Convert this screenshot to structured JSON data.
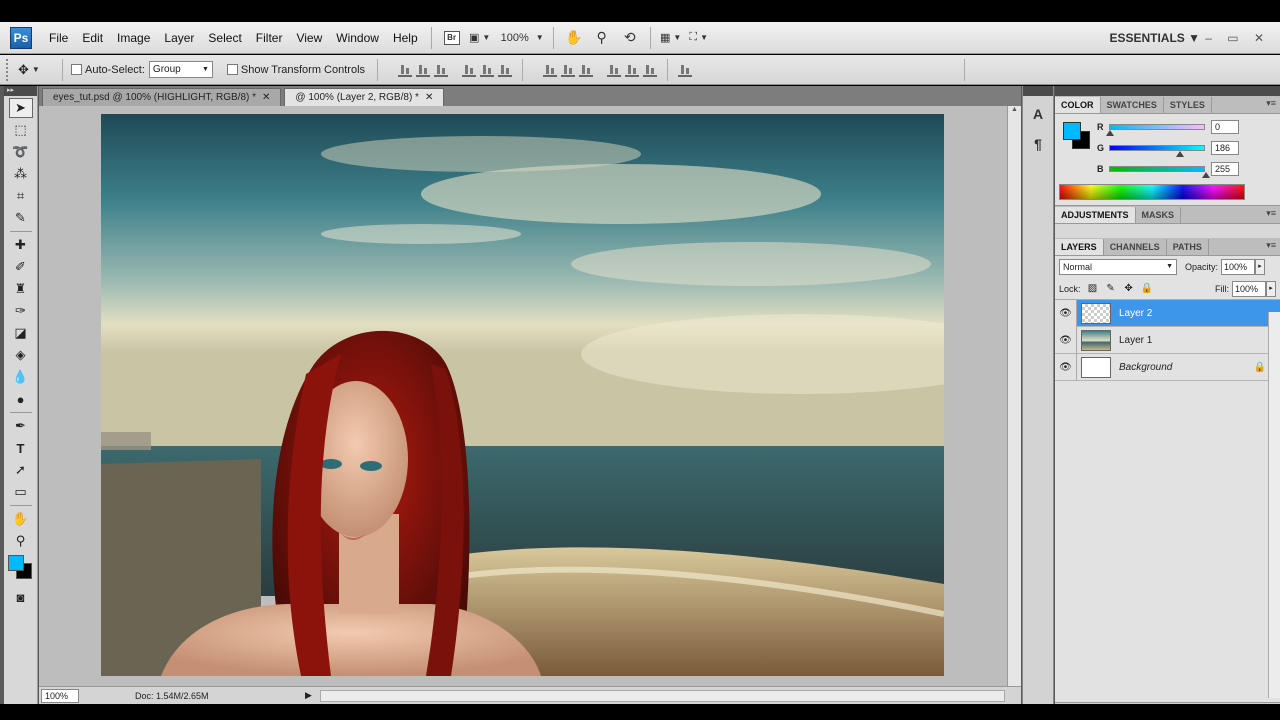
{
  "app": {
    "logo": "Ps"
  },
  "menu": [
    "File",
    "Edit",
    "Image",
    "Layer",
    "Select",
    "Filter",
    "View",
    "Window",
    "Help"
  ],
  "menubar": {
    "bridge": "Br",
    "zoom": "100%",
    "workspace": "ESSENTIALS ▼",
    "window_controls": "–  ▭  ✕"
  },
  "options": {
    "auto_select_label": "Auto-Select:",
    "auto_select_value": "Group",
    "show_transform_label": "Show Transform Controls"
  },
  "tabs": [
    {
      "label": "eyes_tut.psd @ 100% (HIGHLIGHT, RGB/8) *",
      "active": false
    },
    {
      "label": "@ 100% (Layer 2, RGB/8) *",
      "active": true
    }
  ],
  "status": {
    "zoom": "100%",
    "doc": "Doc: 1.54M/2.65M"
  },
  "color_panel": {
    "tabs": [
      "COLOR",
      "SWATCHES",
      "STYLES"
    ],
    "fg_color": "#00baff",
    "bg_color": "#000000",
    "r_label": "R",
    "r": "0",
    "g_label": "G",
    "g": "186",
    "b_label": "B",
    "b": "255"
  },
  "adjust_tabs": [
    "ADJUSTMENTS",
    "MASKS"
  ],
  "layers_panel": {
    "tabs": [
      "LAYERS",
      "CHANNELS",
      "PATHS"
    ],
    "blend_mode": "Normal",
    "opacity_label": "Opacity:",
    "opacity": "100%",
    "lock_label": "Lock:",
    "fill_label": "Fill:",
    "fill": "100%",
    "layers": [
      {
        "name": "Layer 2",
        "selected": true
      },
      {
        "name": "Layer 1",
        "selected": false
      },
      {
        "name": "Background",
        "selected": false,
        "locked": true
      }
    ]
  },
  "icons": {
    "move_tool": "move-icon",
    "marquee": "marquee-icon",
    "lasso": "lasso-icon",
    "eye": "eye-icon",
    "lock": "lock-icon"
  }
}
